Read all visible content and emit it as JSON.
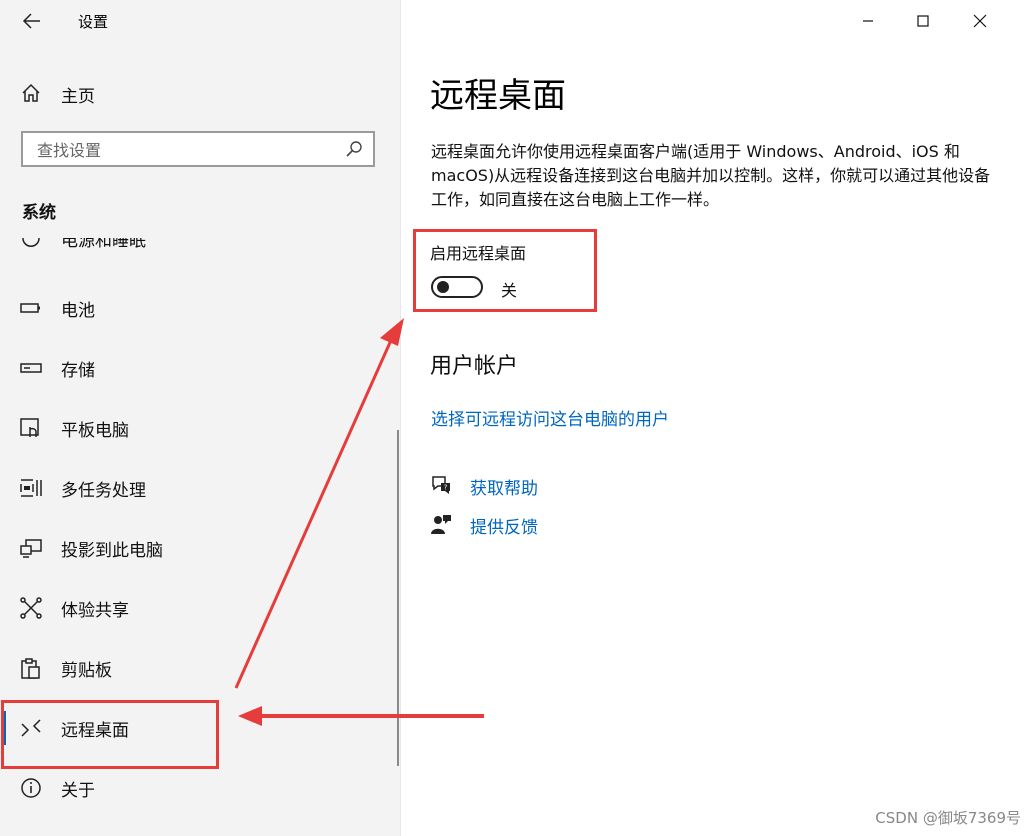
{
  "window": {
    "app_title": "设置",
    "controls": {
      "minimize": "minimize-icon",
      "maximize": "maximize-icon",
      "close": "close-icon"
    }
  },
  "sidebar": {
    "home_label": "主页",
    "search_placeholder": "查找设置",
    "section_title": "系统",
    "items": [
      {
        "label": "电源和睡眠",
        "icon": "power-icon"
      },
      {
        "label": "电池",
        "icon": "battery-icon"
      },
      {
        "label": "存储",
        "icon": "storage-icon"
      },
      {
        "label": "平板电脑",
        "icon": "tablet-icon"
      },
      {
        "label": "多任务处理",
        "icon": "multitasking-icon"
      },
      {
        "label": "投影到此电脑",
        "icon": "project-icon"
      },
      {
        "label": "体验共享",
        "icon": "share-icon"
      },
      {
        "label": "剪贴板",
        "icon": "clipboard-icon"
      },
      {
        "label": "远程桌面",
        "icon": "remote-desktop-icon",
        "selected": true
      },
      {
        "label": "关于",
        "icon": "info-icon"
      }
    ]
  },
  "main": {
    "title": "远程桌面",
    "description": "远程桌面允许你使用远程桌面客户端(适用于 Windows、Android、iOS 和 macOS)从远程设备连接到这台电脑并加以控制。这样，你就可以通过其他设备工作，如同直接在这台电脑上工作一样。",
    "toggle": {
      "label": "启用远程桌面",
      "state_text": "关",
      "on": false
    },
    "accounts": {
      "title": "用户帐户",
      "link": "选择可远程访问这台电脑的用户"
    },
    "help": [
      {
        "label": "获取帮助",
        "icon": "help-chat-icon"
      },
      {
        "label": "提供反馈",
        "icon": "feedback-icon"
      }
    ]
  },
  "watermark": "CSDN @御坂7369号",
  "colors": {
    "accent": "#0067c0",
    "annotation": "#e53c3c",
    "sidebar_bg": "#f3f3f3"
  }
}
